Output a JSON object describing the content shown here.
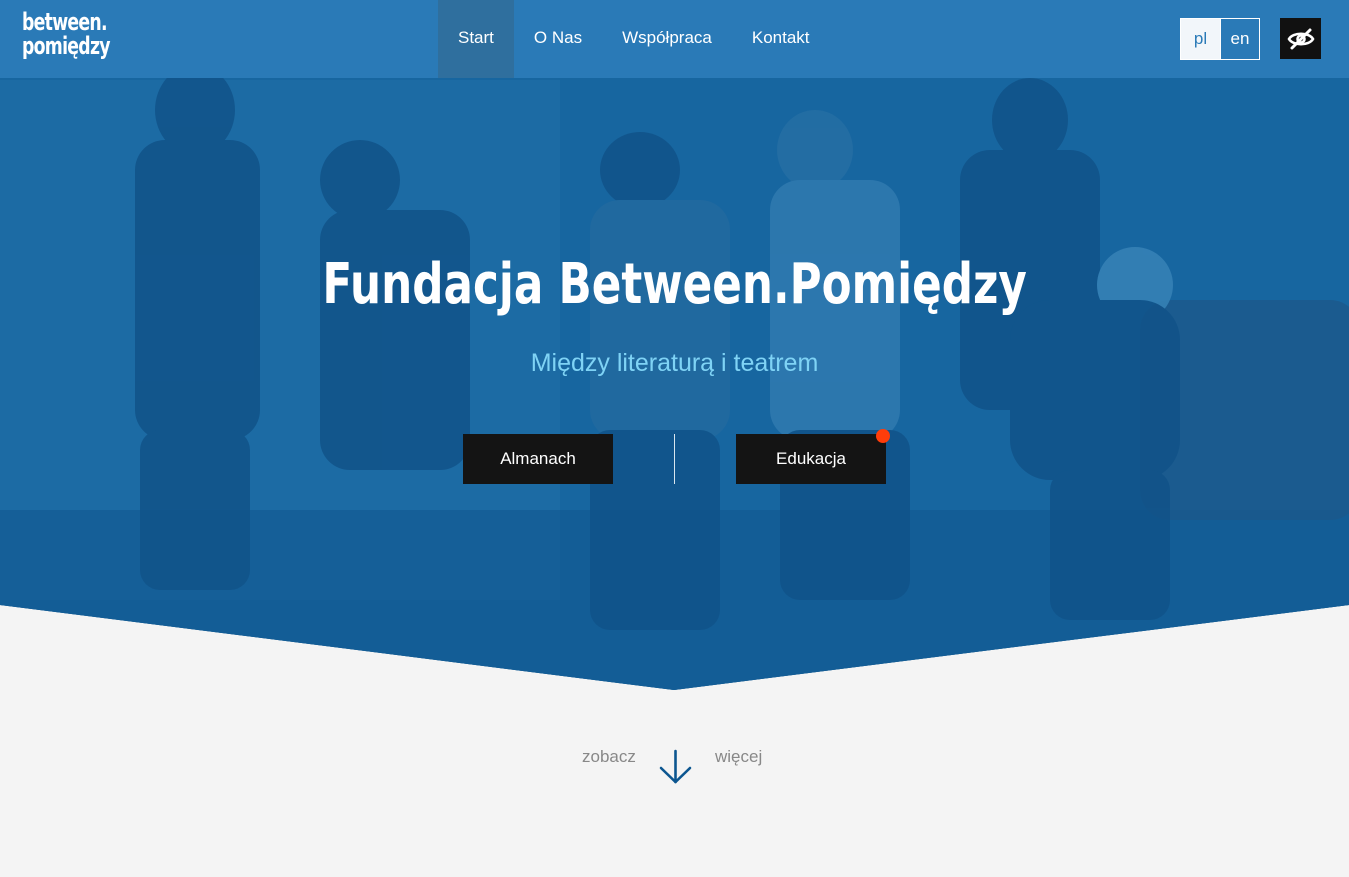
{
  "header": {
    "logo_line1": "between.",
    "logo_line2": "pomiędzy",
    "nav": [
      {
        "label": "Start"
      },
      {
        "label": "O Nas"
      },
      {
        "label": "Współpraca"
      },
      {
        "label": "Kontakt"
      }
    ],
    "lang": {
      "pl": "pl",
      "en": "en"
    },
    "accessibility_icon": "eye-slash-icon"
  },
  "hero": {
    "title": "Fundacja Between.Pomiędzy",
    "subtitle": "Między literaturą i teatrem",
    "buttons": {
      "almanach": "Almanach",
      "edukacja": "Edukacja"
    }
  },
  "more": {
    "left": "zobacz",
    "right": "więcej",
    "icon": "arrow-down-icon"
  },
  "colors": {
    "header_bg": "#2a7ab7",
    "hero_blue": "#1c6aa1",
    "subtitle": "#7fd3f5",
    "button_bg": "#141414",
    "notification_dot": "#ff3d0a",
    "page_bg": "#f4f4f4"
  }
}
